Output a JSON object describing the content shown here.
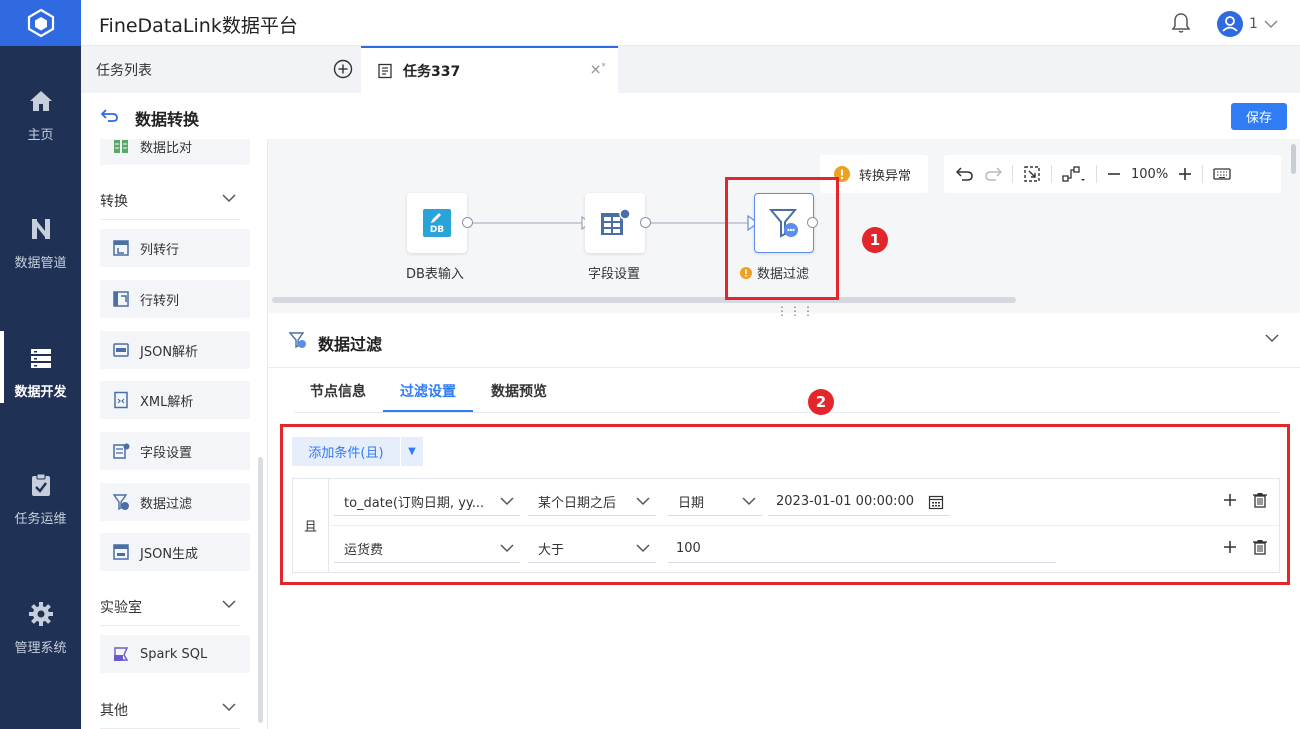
{
  "app": {
    "title": "FineDataLink数据平台"
  },
  "header": {
    "user_name": "1"
  },
  "nav": {
    "items": [
      {
        "label": "主页",
        "icon": "home-icon"
      },
      {
        "label": "数据管道",
        "icon": "pipeline-icon"
      },
      {
        "label": "数据开发",
        "icon": "dev-icon"
      },
      {
        "label": "任务运维",
        "icon": "clipboard-icon"
      },
      {
        "label": "管理系统",
        "icon": "gear-icon"
      }
    ],
    "active": "数据开发"
  },
  "tabs": {
    "list_label": "任务列表",
    "task_label": "任务337",
    "task_modified_mark": "*"
  },
  "page": {
    "title": "数据转换",
    "save_label": "保存"
  },
  "operators": {
    "top_item": "数据比对",
    "categories": [
      {
        "label": "转换",
        "items": [
          "列转行",
          "行转列",
          "JSON解析",
          "XML解析",
          "字段设置",
          "数据过滤",
          "JSON生成"
        ]
      },
      {
        "label": "实验室",
        "items": [
          "Spark SQL"
        ]
      },
      {
        "label": "其他",
        "items": []
      }
    ]
  },
  "canvas": {
    "warning_label": "转换异常",
    "zoom": "100%",
    "nodes": [
      {
        "label": "DB表输入",
        "icon": "db-input-icon"
      },
      {
        "label": "字段设置",
        "icon": "field-settings-icon"
      },
      {
        "label": "数据过滤",
        "icon": "filter-icon",
        "has_warning": true
      }
    ],
    "markers": [
      "1",
      "2"
    ]
  },
  "config": {
    "title": "数据过滤",
    "subtabs": [
      "节点信息",
      "过滤设置",
      "数据预览"
    ],
    "active_subtab": "过滤设置",
    "add_condition_label": "添加条件(且)",
    "logic_label": "且",
    "conditions": [
      {
        "field": "to_date(订购日期, yy...",
        "operator": "某个日期之后",
        "type": "日期",
        "value": "2023-01-01 00:00:00"
      },
      {
        "field": "运货费",
        "operator": "大于",
        "value": "100"
      }
    ]
  },
  "colors": {
    "nav_bg": "#1f3154",
    "accent": "#2f7cf5",
    "highlight": "#e3262b",
    "warning": "#f0a020"
  }
}
